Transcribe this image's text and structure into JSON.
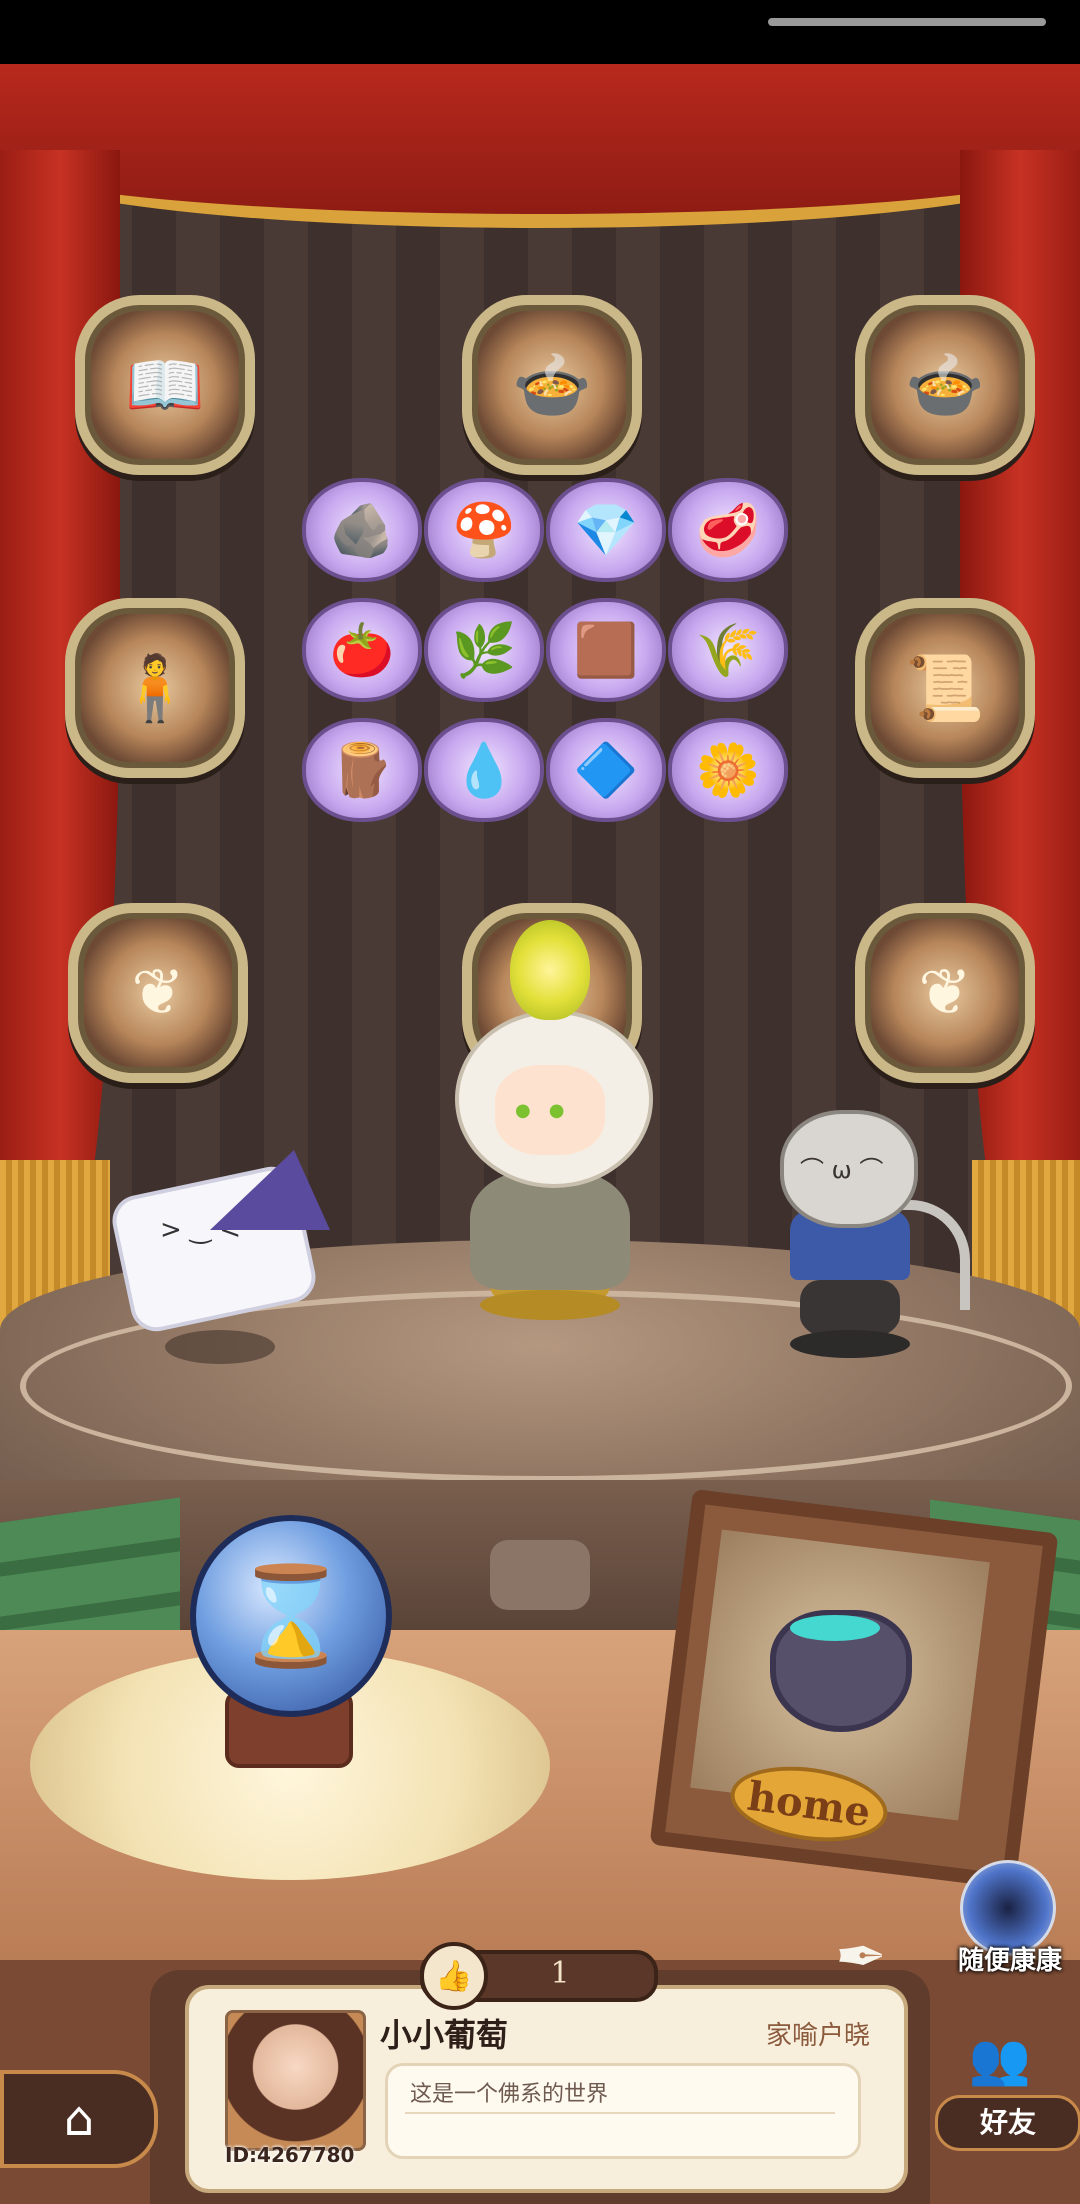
{
  "scene": {
    "frames": [
      {
        "name": "recipe-book",
        "icon": "📖"
      },
      {
        "name": "cauldron-top-center",
        "icon": "🍲"
      },
      {
        "name": "cauldron-top-right",
        "icon": "🍲"
      },
      {
        "name": "doll",
        "icon": "🧍"
      },
      {
        "name": "certificate",
        "icon": "📜"
      },
      {
        "name": "ornament-left",
        "icon": "❦"
      },
      {
        "name": "ornament-center",
        "icon": "🕯"
      },
      {
        "name": "ornament-right",
        "icon": "❦"
      }
    ],
    "ingredients": [
      {
        "name": "charcoal",
        "icon": "🪨"
      },
      {
        "name": "purple-mushroom",
        "icon": "🍄"
      },
      {
        "name": "white-crystal",
        "icon": "💎"
      },
      {
        "name": "red-root",
        "icon": "🥩"
      },
      {
        "name": "tomato",
        "icon": "🍅"
      },
      {
        "name": "green-herb",
        "icon": "🌿"
      },
      {
        "name": "mud",
        "icon": "🟫"
      },
      {
        "name": "wheat",
        "icon": "🌾"
      },
      {
        "name": "ore",
        "icon": "🪵"
      },
      {
        "name": "water-dish",
        "icon": "💧"
      },
      {
        "name": "blue-powder",
        "icon": "🔷"
      },
      {
        "name": "white-flower",
        "icon": "🌼"
      }
    ],
    "orb_icon": "⌛",
    "home_label": "home"
  },
  "random_visit": {
    "label": "随便康康"
  },
  "like": {
    "count": "1",
    "icon": "👍"
  },
  "profile": {
    "nickname": "小小葡萄",
    "title": "家喻户晓",
    "signature": "这是一个佛系的世界",
    "id": "ID:4267780"
  },
  "nav": {
    "home_icon": "⌂",
    "friends_label": "好友"
  }
}
